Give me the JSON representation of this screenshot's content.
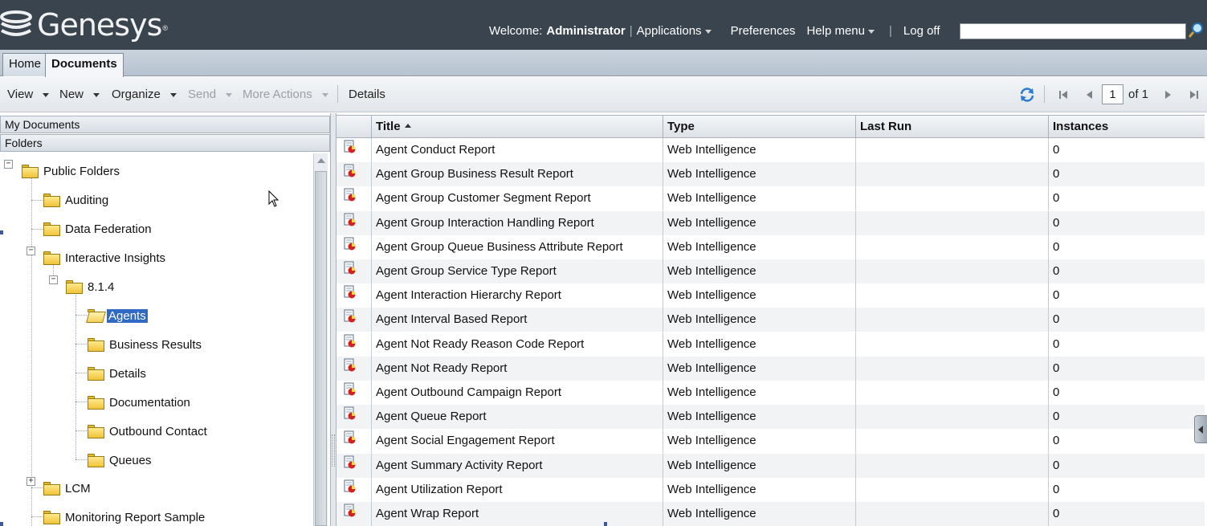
{
  "header": {
    "logo_text": "Genesys",
    "logo_tm": "®",
    "welcome_label": "Welcome:",
    "user": "Administrator",
    "menu": [
      {
        "label": "Applications",
        "has_dropdown": true
      },
      {
        "label": "Preferences",
        "has_dropdown": false
      },
      {
        "label": "Help menu",
        "has_dropdown": true
      },
      {
        "label": "Log off",
        "has_dropdown": false
      }
    ],
    "search_value": ""
  },
  "tabs": [
    {
      "label": "Home",
      "active": false
    },
    {
      "label": "Documents",
      "active": true
    }
  ],
  "toolbar": {
    "view": "View",
    "new": "New",
    "organize": "Organize",
    "send": "Send",
    "more_actions": "More Actions",
    "details": "Details",
    "page_current": "1",
    "page_of": "of 1"
  },
  "left_panel": {
    "my_documents": "My Documents",
    "folders": "Folders",
    "tree": {
      "public_folders": "Public Folders",
      "auditing": "Auditing",
      "data_federation": "Data Federation",
      "interactive_insights": "Interactive Insights",
      "v814": "8.1.4",
      "agents": "Agents",
      "business_results": "Business Results",
      "details": "Details",
      "documentation": "Documentation",
      "outbound_contact": "Outbound Contact",
      "queues": "Queues",
      "lcm": "LCM",
      "monitoring_report_sample": "Monitoring Report Sample"
    }
  },
  "table": {
    "columns": {
      "title": "Title",
      "type": "Type",
      "last_run": "Last Run",
      "instances": "Instances"
    },
    "sort": {
      "column": "Title",
      "direction": "ascending"
    },
    "rows": [
      {
        "title": "Agent Conduct Report",
        "type": "Web Intelligence",
        "last_run": "",
        "instances": "0"
      },
      {
        "title": "Agent Group Business Result Report",
        "type": "Web Intelligence",
        "last_run": "",
        "instances": "0"
      },
      {
        "title": "Agent Group Customer Segment Report",
        "type": "Web Intelligence",
        "last_run": "",
        "instances": "0"
      },
      {
        "title": "Agent Group Interaction Handling Report",
        "type": "Web Intelligence",
        "last_run": "",
        "instances": "0"
      },
      {
        "title": "Agent Group Queue Business Attribute Report",
        "type": "Web Intelligence",
        "last_run": "",
        "instances": "0"
      },
      {
        "title": "Agent Group Service Type Report",
        "type": "Web Intelligence",
        "last_run": "",
        "instances": "0"
      },
      {
        "title": "Agent Interaction Hierarchy Report",
        "type": "Web Intelligence",
        "last_run": "",
        "instances": "0"
      },
      {
        "title": "Agent Interval Based Report",
        "type": "Web Intelligence",
        "last_run": "",
        "instances": "0"
      },
      {
        "title": "Agent Not Ready Reason Code Report",
        "type": "Web Intelligence",
        "last_run": "",
        "instances": "0"
      },
      {
        "title": "Agent Not Ready Report",
        "type": "Web Intelligence",
        "last_run": "",
        "instances": "0"
      },
      {
        "title": "Agent Outbound Campaign Report",
        "type": "Web Intelligence",
        "last_run": "",
        "instances": "0"
      },
      {
        "title": "Agent Queue Report",
        "type": "Web Intelligence",
        "last_run": "",
        "instances": "0"
      },
      {
        "title": "Agent Social Engagement Report",
        "type": "Web Intelligence",
        "last_run": "",
        "instances": "0"
      },
      {
        "title": "Agent Summary Activity Report",
        "type": "Web Intelligence",
        "last_run": "",
        "instances": "0"
      },
      {
        "title": "Agent Utilization Report",
        "type": "Web Intelligence",
        "last_run": "",
        "instances": "0"
      },
      {
        "title": "Agent Wrap Report",
        "type": "Web Intelligence",
        "last_run": "",
        "instances": "0"
      }
    ]
  },
  "colors": {
    "header_bg": "#3a444e",
    "selection": "#316ac5",
    "folder": "#f0c23a"
  }
}
